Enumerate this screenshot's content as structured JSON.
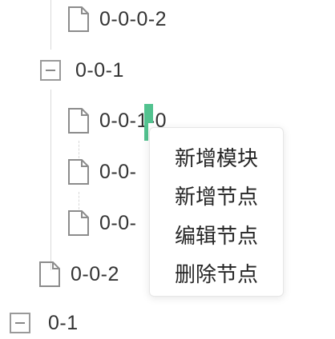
{
  "tree": {
    "nodes": [
      {
        "id": "n1",
        "label": "0-0-0-2",
        "type": "file"
      },
      {
        "id": "n2",
        "label": "0-0-1",
        "type": "folder-expanded"
      },
      {
        "id": "n3",
        "label": "0-0-1-0",
        "type": "file"
      },
      {
        "id": "n4",
        "label": "0-0-",
        "type": "file"
      },
      {
        "id": "n5",
        "label": "0-0-",
        "type": "file"
      },
      {
        "id": "n6",
        "label": "0-0-2",
        "type": "file"
      },
      {
        "id": "n7",
        "label": "0-1",
        "type": "folder"
      }
    ]
  },
  "context_menu": {
    "items": [
      "新增模块",
      "新增节点",
      "编辑节点",
      "删除节点"
    ]
  },
  "colors": {
    "cursor_highlight": "#52c28f",
    "guide_line": "#d9d9d9"
  }
}
